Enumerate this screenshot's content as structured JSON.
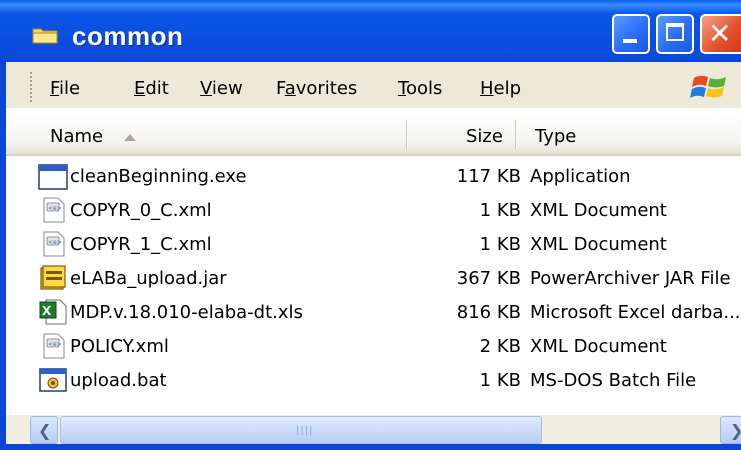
{
  "window": {
    "title": "common",
    "colors": {
      "titlebar": "#0a4fe0",
      "close_button": "#e4502a",
      "menubar": "#ece9d8"
    }
  },
  "menu": {
    "items": [
      {
        "label": "File",
        "underline": "F"
      },
      {
        "label": "Edit",
        "underline": "E"
      },
      {
        "label": "View",
        "underline": "V"
      },
      {
        "label": "Favorites",
        "underline": "a"
      },
      {
        "label": "Tools",
        "underline": "T"
      },
      {
        "label": "Help",
        "underline": "H"
      }
    ]
  },
  "columns": {
    "name": "Name",
    "size": "Size",
    "type": "Type"
  },
  "files": [
    {
      "name": "cleanBeginning.exe",
      "size": "117 KB",
      "type": "Application",
      "icon": "application-exe-icon"
    },
    {
      "name": "COPYR_0_C.xml",
      "size": "1 KB",
      "type": "XML Document",
      "icon": "xml-document-icon"
    },
    {
      "name": "COPYR_1_C.xml",
      "size": "1 KB",
      "type": "XML Document",
      "icon": "xml-document-icon"
    },
    {
      "name": "eLABa_upload.jar",
      "size": "367 KB",
      "type": "PowerArchiver JAR File",
      "icon": "jar-archive-icon"
    },
    {
      "name": "MDP.v.18.010-elaba-dt.xls",
      "size": "816 KB",
      "type": "Microsoft Excel darba...",
      "icon": "excel-document-icon"
    },
    {
      "name": "POLICY.xml",
      "size": "2 KB",
      "type": "XML Document",
      "icon": "xml-document-icon"
    },
    {
      "name": "upload.bat",
      "size": "1 KB",
      "type": "MS-DOS Batch File",
      "icon": "batch-file-icon"
    }
  ]
}
